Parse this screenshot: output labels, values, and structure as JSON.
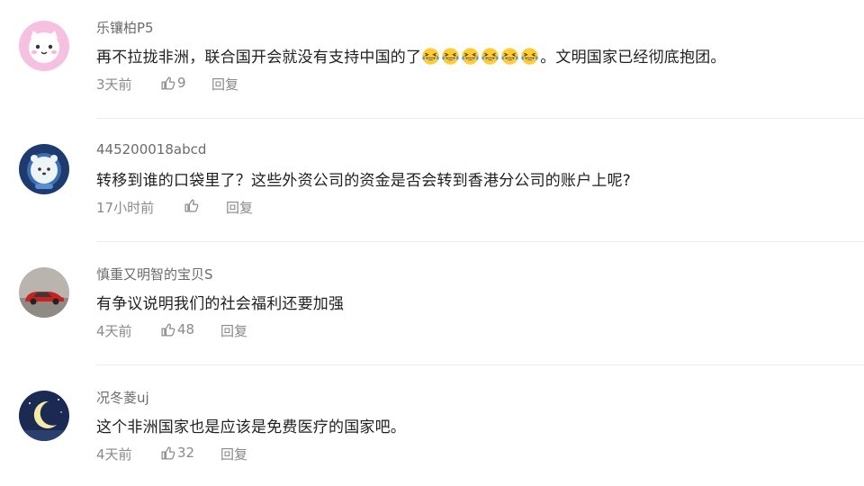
{
  "comments": [
    {
      "username": "乐镶柏P5",
      "text_before": "再不拉拢非洲，联合国开会就没有支持中国的了",
      "emoji": "laugh-cry-emoji",
      "emoji_count": 6,
      "text_after": "。文明国家已经彻底抱团。",
      "time": "3天前",
      "likes": "9",
      "reply_label": "回复"
    },
    {
      "username": "445200018abcd",
      "text": "转移到谁的口袋里了？这些外资公司的资金是否会转到香港分公司的账户上呢?",
      "time": "17小时前",
      "likes": "",
      "reply_label": "回复"
    },
    {
      "username": "慎重又明智的宝贝S",
      "text": "有争议说明我们的社会福利还要加强",
      "time": "4天前",
      "likes": "48",
      "reply_label": "回复"
    },
    {
      "username": "况冬菱uj",
      "text": "这个非洲国家也是应该是免费医疗的国家吧。",
      "time": "4天前",
      "likes": "32",
      "reply_label": "回复"
    }
  ],
  "colors": {
    "username": "#6b6b6b",
    "text": "#1f1f1f",
    "meta": "#8a8a8a",
    "divider": "#ececec"
  }
}
